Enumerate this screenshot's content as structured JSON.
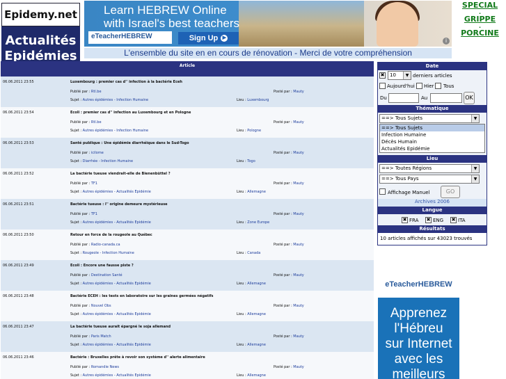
{
  "logo": {
    "top": "Epidemy.net",
    "bottom_line1": "Actualités",
    "bottom_line2": "Epidémies"
  },
  "banner": {
    "headline1": "Learn HEBREW Online",
    "headline2": "with Israel's best teachers",
    "brand": "eTeacherHEBREW",
    "signup": "Sign Up",
    "signup_icon": "arrow-circle-icon"
  },
  "special": {
    "items": [
      "SPECIAL",
      "GRIPPE",
      "PORCINE"
    ],
    "separator": "."
  },
  "notice": "L'ensemble du site en en cours de rénovation - Merci de votre compréhension",
  "articles": {
    "header": "Article",
    "pub_label": "Publié par :",
    "by_label": "Posté par :",
    "subj_label": "Sujet :",
    "lieu_label": "Lieu :",
    "rows": [
      {
        "date": "06.06.2011 23:55",
        "title": "Luxembourg : premier cas d'' infection à la bactérie Eceh",
        "publisher": "Rtl.be",
        "poster": "Mauty",
        "subject": "Autres épidémies - Infection Humaine",
        "lieu": "Luxembourg"
      },
      {
        "date": "06.06.2011 23:54",
        "title": "Ecoli : premier cas d'' infection au Luxembourg et en Pologne",
        "publisher": "Rtl.be",
        "poster": "Mauty",
        "subject": "Autres épidémies - Infection Humaine",
        "lieu": "Pologne"
      },
      {
        "date": "06.06.2011 23:53",
        "title": "Santé publique : Une épidémie diarrhéique dans le Sud-Togo",
        "publisher": "icilome",
        "poster": "Mauty",
        "subject": "Diarrhée - Infection Humaine",
        "lieu": "Togo"
      },
      {
        "date": "06.06.2011 23:52",
        "title": "La bactérie tueuse viendrait-elle de Bienenbüttel ?",
        "publisher": "TF1",
        "poster": "Mauty",
        "subject": "Autres épidémies - Actualités Epidémie",
        "lieu": "Allemagne"
      },
      {
        "date": "06.06.2011 23:51",
        "title": "Bactérie tueuse : l'' origine demeure mystérieuse",
        "publisher": "TF1",
        "poster": "Mauty",
        "subject": "Autres épidémies - Actualités Epidémie",
        "lieu": "Zone Europe"
      },
      {
        "date": "06.06.2011 23:50",
        "title": "Retour en force de la rougeole au Québec",
        "publisher": "Radio-canada.ca",
        "poster": "Mauty",
        "subject": "Rougeole - Infection Humaine",
        "lieu": "Canada"
      },
      {
        "date": "06.06.2011 23:49",
        "title": "Ecoli : Encore une fausse piste ?",
        "publisher": "Destination Santé",
        "poster": "Mauty",
        "subject": "Autres épidémies - Actualités Epidémie",
        "lieu": "Allemagne"
      },
      {
        "date": "06.06.2011 23:48",
        "title": "Bactérie ECEH : les tests en laboratoire sur les graines germées négatifs",
        "publisher": "Nouvel Obs",
        "poster": "Mauty",
        "subject": "Autres épidémies - Actualités Epidémie",
        "lieu": "Allemagne"
      },
      {
        "date": "06.06.2011 23:47",
        "title": "La bactérie tueuse aurait épargné le soja allemand",
        "publisher": "Paris Match",
        "poster": "Mauty",
        "subject": "Autres épidémies - Actualités Epidémie",
        "lieu": "Allemagne"
      },
      {
        "date": "06.06.2011 23:46",
        "title": "Bactérie : Bruxelles prête à revoir son système d'' alerte alimentaire",
        "publisher": "Romandie News",
        "poster": "Mauty",
        "subject": "Autres épidémies - Actualités Epidémie",
        "lieu": "Allemagne"
      }
    ]
  },
  "panel": {
    "date_title": "Date",
    "count_value": "10",
    "count_suffix": "derniers articles",
    "today": "Aujourd'hui",
    "yesterday": "Hier",
    "all": "Tous",
    "du": "Du",
    "au": "Au",
    "ok": "OK",
    "thematique_title": "Thématique",
    "thematique_select": "==> Tous Sujets",
    "thematique_list": [
      "==> Tous Sujets",
      "Infection Humaine",
      "Décès Humain",
      "Actualités Epidémie"
    ],
    "lieu_title": "Lieu",
    "region_select": "==> Toutes Régions",
    "country_select": "==> Tous Pays",
    "manual": "Affichage Manuel",
    "go": "GO",
    "archives": "Archives 2006",
    "langue_title": "Langue",
    "langs": [
      "FRA",
      "ENG",
      "ITA"
    ],
    "resultats_title": "Résultats",
    "resultats_text": "10 articles affichés sur 43023 trouvés"
  },
  "ad": {
    "brand": "eTeacherHEBREW",
    "line1": "Apprenez",
    "line2": "l'Hébreu",
    "line3": "sur Internet",
    "line4": "avec les",
    "line5": "meilleurs"
  },
  "colors": {
    "navy": "#2b3381",
    "green": "#117a1a",
    "row_odd": "#dbe6f2",
    "notice_text": "#1a3a8a"
  }
}
